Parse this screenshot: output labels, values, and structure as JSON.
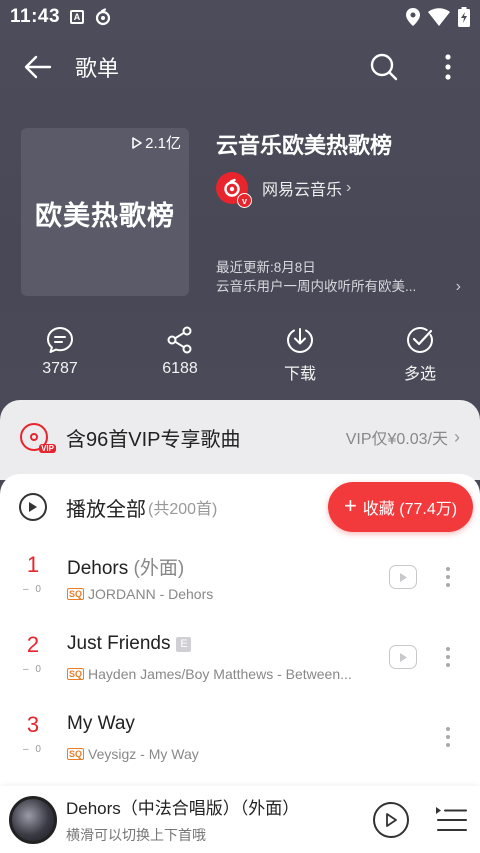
{
  "status_bar": {
    "time": "11:43"
  },
  "header": {
    "title": "歌单"
  },
  "playlist": {
    "cover_text": "欧美热歌榜",
    "play_count": "2.1亿",
    "title": "云音乐欧美热歌榜",
    "creator": "网易云音乐",
    "last_update": "最近更新:8月8日",
    "description": "云音乐用户一周内收听所有欧美..."
  },
  "actions": [
    {
      "label": "3787",
      "icon": "comment-icon"
    },
    {
      "label": "6188",
      "icon": "share-icon"
    },
    {
      "label": "下载",
      "icon": "download-icon"
    },
    {
      "label": "多选",
      "icon": "multi-select-icon"
    }
  ],
  "vip": {
    "text": "含96首VIP专享歌曲",
    "price": "VIP仅¥0.03/天"
  },
  "play_all": {
    "label": "播放全部",
    "count": "(共200首)"
  },
  "collect": {
    "label": "收藏 (77.4万)"
  },
  "tracks": [
    {
      "index": "1",
      "delta": "– 0",
      "title": "Dehors",
      "alias": " (外面)",
      "explicit": "",
      "artist": "JORDANN - Dehors",
      "quality": "SQ",
      "has_mv": true
    },
    {
      "index": "2",
      "delta": "– 0",
      "title": "Just Friends",
      "alias": "",
      "explicit": "E",
      "artist": "Hayden James/Boy Matthews - Between...",
      "quality": "SQ",
      "has_mv": true
    },
    {
      "index": "3",
      "delta": "– 0",
      "title": "My Way",
      "alias": "",
      "explicit": "",
      "artist": "Veysigz - My Way",
      "quality": "SQ",
      "has_mv": false
    }
  ],
  "mini_player": {
    "title": "Dehors（中法合唱版）（外面）",
    "hint": "横滑可以切换上下首哦"
  },
  "colors": {
    "accent": "#e8242d",
    "collect": "#f23a3c",
    "header_bg": "#4a4a56"
  }
}
